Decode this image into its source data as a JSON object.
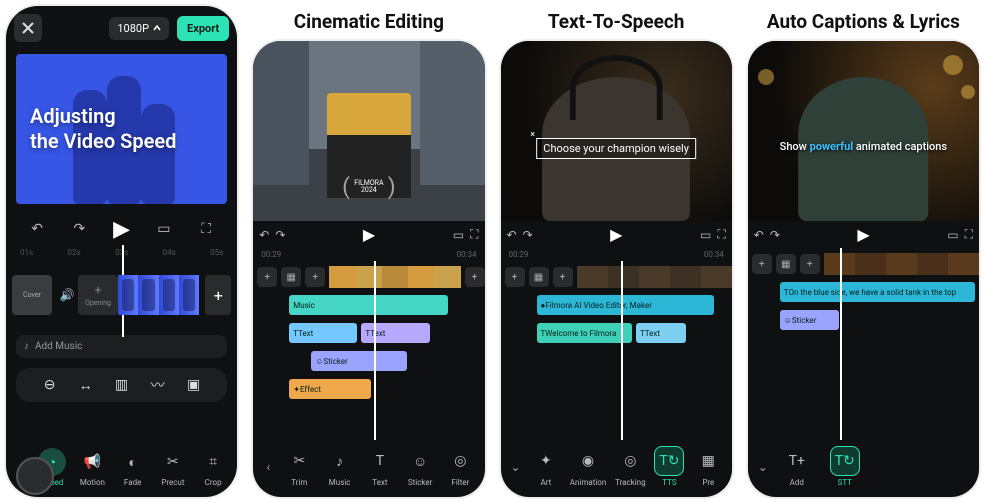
{
  "phone1": {
    "resolution": "1080P",
    "export_label": "Export",
    "preview_text": "Adjusting\nthe Video Speed",
    "ticks": [
      "01s",
      "02s",
      "03s",
      "04s",
      "05s"
    ],
    "cover_label": "Cover",
    "opening_label": "Opening",
    "add_music_label": "Add Music",
    "bottom_tools": [
      {
        "label": "Speed",
        "active": true
      },
      {
        "label": "Motion",
        "active": false
      },
      {
        "label": "Fade",
        "active": false
      },
      {
        "label": "Precut",
        "active": false
      },
      {
        "label": "Crop",
        "active": false
      }
    ]
  },
  "card2": {
    "title": "Cinematic Editing",
    "badge_line1": "FILMORA",
    "badge_line2": "2024",
    "timecode_left": "00:29",
    "timecode_right": "00:34",
    "tracks": {
      "music": {
        "label": "Music",
        "color": "#46d6c5"
      },
      "text": [
        {
          "label": "Text",
          "color": "#75c8ff"
        },
        {
          "label": "Text",
          "color": "#b6a8ff"
        }
      ],
      "sticker": {
        "label": "Sticker",
        "color": "#9aa4ff"
      },
      "effect": {
        "label": "Effect",
        "color": "#f0a84c"
      }
    },
    "tools": [
      {
        "label": "Trim",
        "active": false
      },
      {
        "label": "Music",
        "active": false
      },
      {
        "label": "Text",
        "active": false
      },
      {
        "label": "Sticker",
        "active": false
      },
      {
        "label": "Filter",
        "active": false
      }
    ]
  },
  "card3": {
    "title": "Text-To-Speech",
    "overlay": "Choose your champion wisely",
    "timecode_left": "00:29",
    "timecode_right": "00:34",
    "tracks": {
      "ai": {
        "label": "Filmora AI Video Editor, Maker",
        "color": "#2db7d6"
      },
      "welcome": {
        "label": "Welcome to Filmora",
        "color": "#3ed1b8"
      },
      "text": {
        "label": "Text",
        "color": "#7ccff0"
      }
    },
    "tools": [
      {
        "label": "Art",
        "active": false
      },
      {
        "label": "Animation",
        "active": false
      },
      {
        "label": "Tracking",
        "active": false
      },
      {
        "label": "TTS",
        "active": true
      },
      {
        "label": "Pre",
        "active": false
      }
    ]
  },
  "card4": {
    "title": "Auto Captions & Lyrics",
    "caption_pre": "Show ",
    "caption_hl": "powerful",
    "caption_post": " animated captions",
    "tracks": {
      "caption": {
        "label": "On the blue side, we have a solid tank in the top",
        "color": "#2db7d6"
      },
      "sticker": {
        "label": "Sticker",
        "color": "#9aa4ff"
      }
    },
    "tools": [
      {
        "label": "Add",
        "active": false
      },
      {
        "label": "STT",
        "active": true
      }
    ]
  }
}
